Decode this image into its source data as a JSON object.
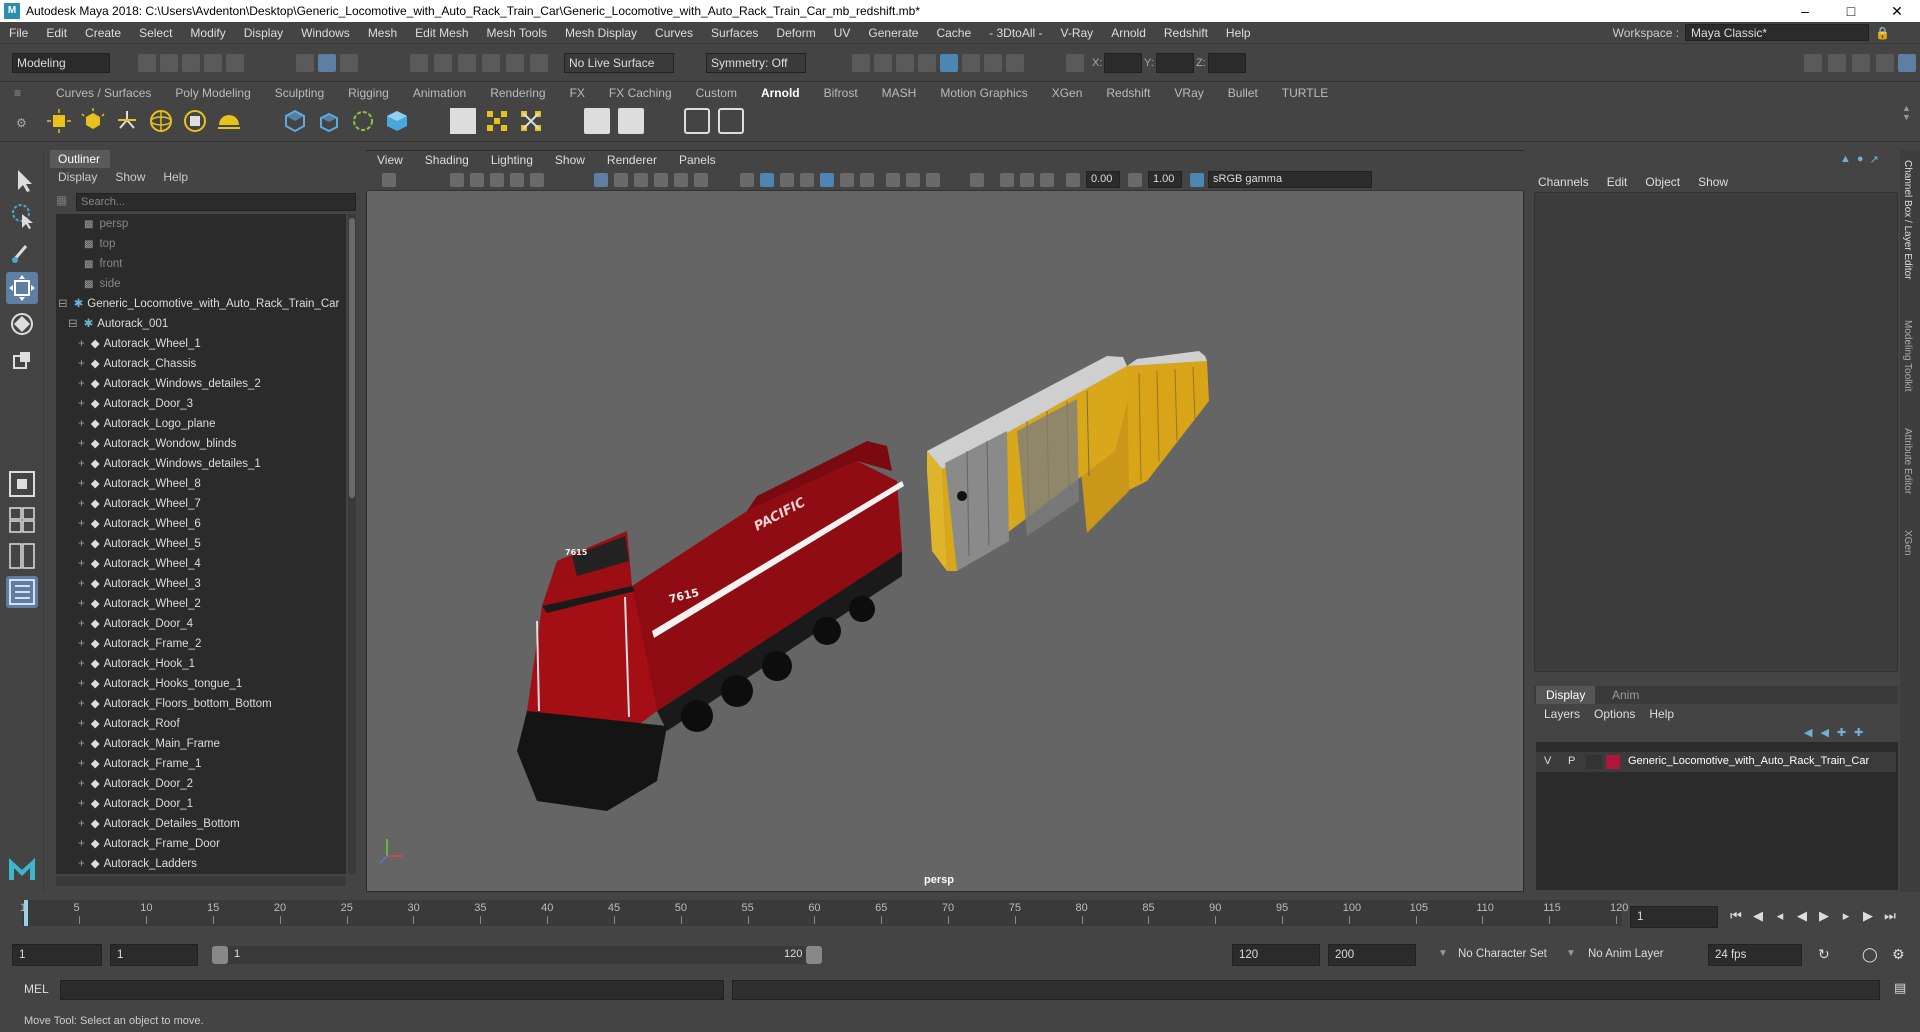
{
  "window": {
    "title": "Autodesk Maya 2018: C:\\Users\\Avdenton\\Desktop\\Generic_Locomotive_with_Auto_Rack_Train_Car\\Generic_Locomotive_with_Auto_Rack_Train_Car_mb_redshift.mb*"
  },
  "menubar": [
    "File",
    "Edit",
    "Create",
    "Select",
    "Modify",
    "Display",
    "Windows",
    "Mesh",
    "Edit Mesh",
    "Mesh Tools",
    "Mesh Display",
    "Curves",
    "Surfaces",
    "Deform",
    "UV",
    "Generate",
    "Cache",
    "- 3DtoAll -",
    "V-Ray",
    "Arnold",
    "Redshift",
    "Help"
  ],
  "workspace": {
    "label": "Workspace :",
    "value": "Maya Classic*"
  },
  "statusline": {
    "mode": "Modeling",
    "live_surface": "No Live Surface",
    "symmetry": "Symmetry: Off",
    "x_label": "X:",
    "y_label": "Y:",
    "z_label": "Z:"
  },
  "shelf_tabs": [
    "Curves / Surfaces",
    "Poly Modeling",
    "Sculpting",
    "Rigging",
    "Animation",
    "Rendering",
    "FX",
    "FX Caching",
    "Custom",
    "Arnold",
    "Bifrost",
    "MASH",
    "Motion Graphics",
    "XGen",
    "Redshift",
    "VRay",
    "Bullet",
    "TURTLE"
  ],
  "shelf_active": "Arnold",
  "outliner": {
    "tab": "Outliner",
    "menu": [
      "Display",
      "Show",
      "Help"
    ],
    "search_placeholder": "Search...",
    "rows": [
      {
        "label": "persp",
        "type": "cam"
      },
      {
        "label": "top",
        "type": "cam"
      },
      {
        "label": "front",
        "type": "cam"
      },
      {
        "label": "side",
        "type": "cam"
      },
      {
        "label": "Generic_Locomotive_with_Auto_Rack_Train_Car",
        "type": "group",
        "level": 0
      },
      {
        "label": "Autorack_001",
        "type": "group",
        "level": 1
      },
      {
        "label": "Autorack_Wheel_1",
        "type": "mesh"
      },
      {
        "label": "Autorack_Chassis",
        "type": "mesh"
      },
      {
        "label": "Autorack_Windows_detailes_2",
        "type": "mesh"
      },
      {
        "label": "Autorack_Door_3",
        "type": "mesh"
      },
      {
        "label": "Autorack_Logo_plane",
        "type": "mesh"
      },
      {
        "label": "Autorack_Wondow_blinds",
        "type": "mesh"
      },
      {
        "label": "Autorack_Windows_detailes_1",
        "type": "mesh"
      },
      {
        "label": "Autorack_Wheel_8",
        "type": "mesh"
      },
      {
        "label": "Autorack_Wheel_7",
        "type": "mesh"
      },
      {
        "label": "Autorack_Wheel_6",
        "type": "mesh"
      },
      {
        "label": "Autorack_Wheel_5",
        "type": "mesh"
      },
      {
        "label": "Autorack_Wheel_4",
        "type": "mesh"
      },
      {
        "label": "Autorack_Wheel_3",
        "type": "mesh"
      },
      {
        "label": "Autorack_Wheel_2",
        "type": "mesh"
      },
      {
        "label": "Autorack_Door_4",
        "type": "mesh"
      },
      {
        "label": "Autorack_Frame_2",
        "type": "mesh"
      },
      {
        "label": "Autorack_Hook_1",
        "type": "mesh"
      },
      {
        "label": "Autorack_Hooks_tongue_1",
        "type": "mesh"
      },
      {
        "label": "Autorack_Floors_bottom_Bottom",
        "type": "mesh"
      },
      {
        "label": "Autorack_Roof",
        "type": "mesh"
      },
      {
        "label": "Autorack_Main_Frame",
        "type": "mesh"
      },
      {
        "label": "Autorack_Frame_1",
        "type": "mesh"
      },
      {
        "label": "Autorack_Door_2",
        "type": "mesh"
      },
      {
        "label": "Autorack_Door_1",
        "type": "mesh"
      },
      {
        "label": "Autorack_Detailes_Bottom",
        "type": "mesh"
      },
      {
        "label": "Autorack_Frame_Door",
        "type": "mesh"
      },
      {
        "label": "Autorack_Ladders",
        "type": "mesh"
      }
    ]
  },
  "viewport": {
    "menu": [
      "View",
      "Shading",
      "Lighting",
      "Show",
      "Renderer",
      "Panels"
    ],
    "near_value": "0.00",
    "far_value": "1.00",
    "color_space": "sRGB gamma",
    "camera_label": "persp",
    "loco_text": "PACIFIC",
    "loco_number": "7615"
  },
  "channel_box": {
    "menu": [
      "Channels",
      "Edit",
      "Object",
      "Show"
    ]
  },
  "side_tabs": [
    "Channel Box / Layer Editor",
    "Modeling Toolkit",
    "Attribute Editor",
    "XGen"
  ],
  "layer_editor": {
    "tabs": [
      "Display",
      "Anim"
    ],
    "menu": [
      "Layers",
      "Options",
      "Help"
    ],
    "layer": {
      "v": "V",
      "p": "P",
      "name": "Generic_Locomotive_with_Auto_Rack_Train_Car",
      "color": "#b0163a"
    }
  },
  "timeline": {
    "ticks": [
      1,
      5,
      10,
      15,
      20,
      25,
      30,
      35,
      40,
      45,
      50,
      55,
      60,
      65,
      70,
      75,
      80,
      85,
      90,
      95,
      100,
      105,
      110,
      115,
      120
    ],
    "current_frame": "1"
  },
  "range": {
    "start": "1",
    "playback_start": "1",
    "slider_start": "1",
    "slider_end": "120",
    "playback_end": "120",
    "end": "200",
    "character_set": "No Character Set",
    "anim_layer": "No Anim Layer",
    "fps": "24 fps"
  },
  "mel": {
    "label": "MEL"
  },
  "help_line": "Move Tool: Select an object to move."
}
